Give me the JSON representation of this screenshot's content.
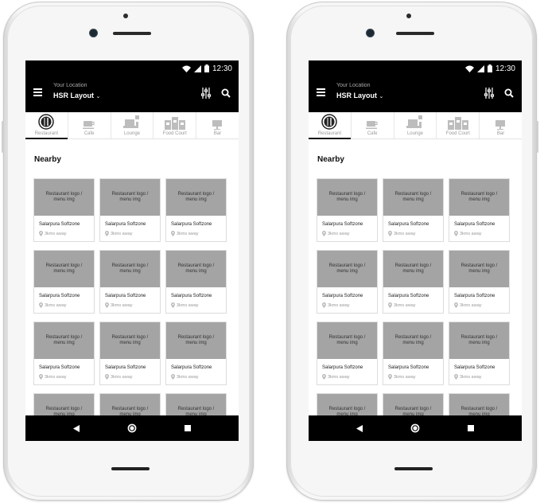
{
  "status_bar": {
    "time": "12:30"
  },
  "header": {
    "location_label": "Your Location",
    "location_value": "HSR Layout",
    "location_chevron": "⌄"
  },
  "tabs": [
    {
      "label": "Restaurant",
      "icon": "restaurant-icon",
      "active": true
    },
    {
      "label": "Cafe",
      "icon": "cafe-icon"
    },
    {
      "label": "Lounge",
      "icon": "lounge-icon"
    },
    {
      "label": "Food Court",
      "icon": "food-court-icon"
    },
    {
      "label": "Bar",
      "icon": "bar-icon"
    }
  ],
  "section": {
    "title": "Nearby"
  },
  "card": {
    "image_text": "Restaurant logo / menu img",
    "name": "Salarpura Softzone",
    "distance": "3kms away"
  },
  "nav": {
    "back": "back-icon",
    "home": "home-icon",
    "recents": "recents-icon"
  },
  "colors": {
    "app_bar": "#000000",
    "placeholder": "#a4a4a4",
    "card_border": "#dcdcdc"
  }
}
